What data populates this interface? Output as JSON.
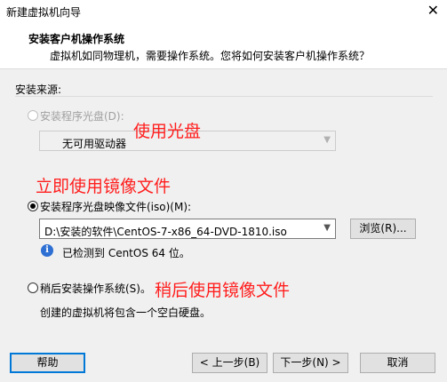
{
  "window": {
    "title": "新建虚拟机向导",
    "close_glyph": "✕"
  },
  "header": {
    "title": "安装客户机操作系统",
    "subtitle": "虚拟机如同物理机，需要操作系统。您将如何安装客户机操作系统？"
  },
  "install_source": {
    "label": "安装来源:",
    "disc_option": {
      "label": "安装程序光盘(D):",
      "selected": false,
      "enabled": false,
      "combo_value": "无可用驱动器"
    },
    "iso_option": {
      "label": "安装程序光盘映像文件(iso)(M):",
      "selected": true,
      "enabled": true,
      "path_value": "D:\\安装的软件\\CentOS-7-x86_64-DVD-1810.iso",
      "browse_label": "浏览(R)...",
      "detect_info": "已检测到 CentOS 64 位。"
    },
    "later_option": {
      "label": "稍后安装操作系统(S)。",
      "selected": false,
      "enabled": true,
      "description": "创建的虚拟机将包含一个空白硬盘。"
    }
  },
  "annotations": {
    "use_disc": "使用光盘",
    "use_image_now": "立即使用镜像文件",
    "use_image_later": "稍后使用镜像文件",
    "color": "#ff1e1e"
  },
  "footer": {
    "help_label": "帮助",
    "back_label": "< 上一步(B)",
    "next_label": "下一步(N) >",
    "cancel_label": "取消"
  },
  "icons": {
    "info": "info-icon",
    "dropdown": "chevron-down-icon",
    "close": "close-icon"
  }
}
